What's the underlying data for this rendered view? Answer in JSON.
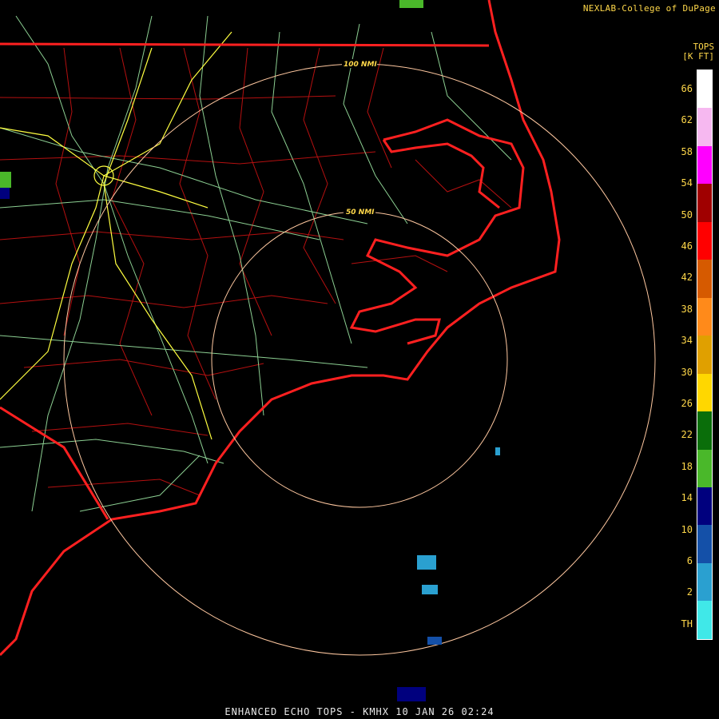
{
  "credit": "NEXLAB-College of DuPage",
  "footer": "ENHANCED ECHO TOPS - KMHX 10 JAN 26 02:24",
  "legend": {
    "title_line1": "TOPS",
    "title_line2": "[K FT]",
    "ticks": [
      "66",
      "62",
      "58",
      "54",
      "50",
      "46",
      "42",
      "38",
      "34",
      "30",
      "26",
      "22",
      "18",
      "14",
      "10",
      "6",
      "2",
      "TH"
    ],
    "colors": [
      "#ffffff",
      "#f6b8f0",
      "#ff00ff",
      "#a00000",
      "#ff0000",
      "#d65a00",
      "#ff8a1a",
      "#e0a000",
      "#ffd700",
      "#0a6e0a",
      "#4ab82a",
      "#00007e",
      "#1450a8",
      "#2aa0d0",
      "#40e8e8"
    ]
  },
  "rings": [
    "100 NMI",
    "50 NMI"
  ],
  "colors": {
    "coast": "#ff2020",
    "counties": "#c01010",
    "roads": "#9ad8a0",
    "interstates": "#ffff40",
    "rings": "#ffc8a0"
  }
}
